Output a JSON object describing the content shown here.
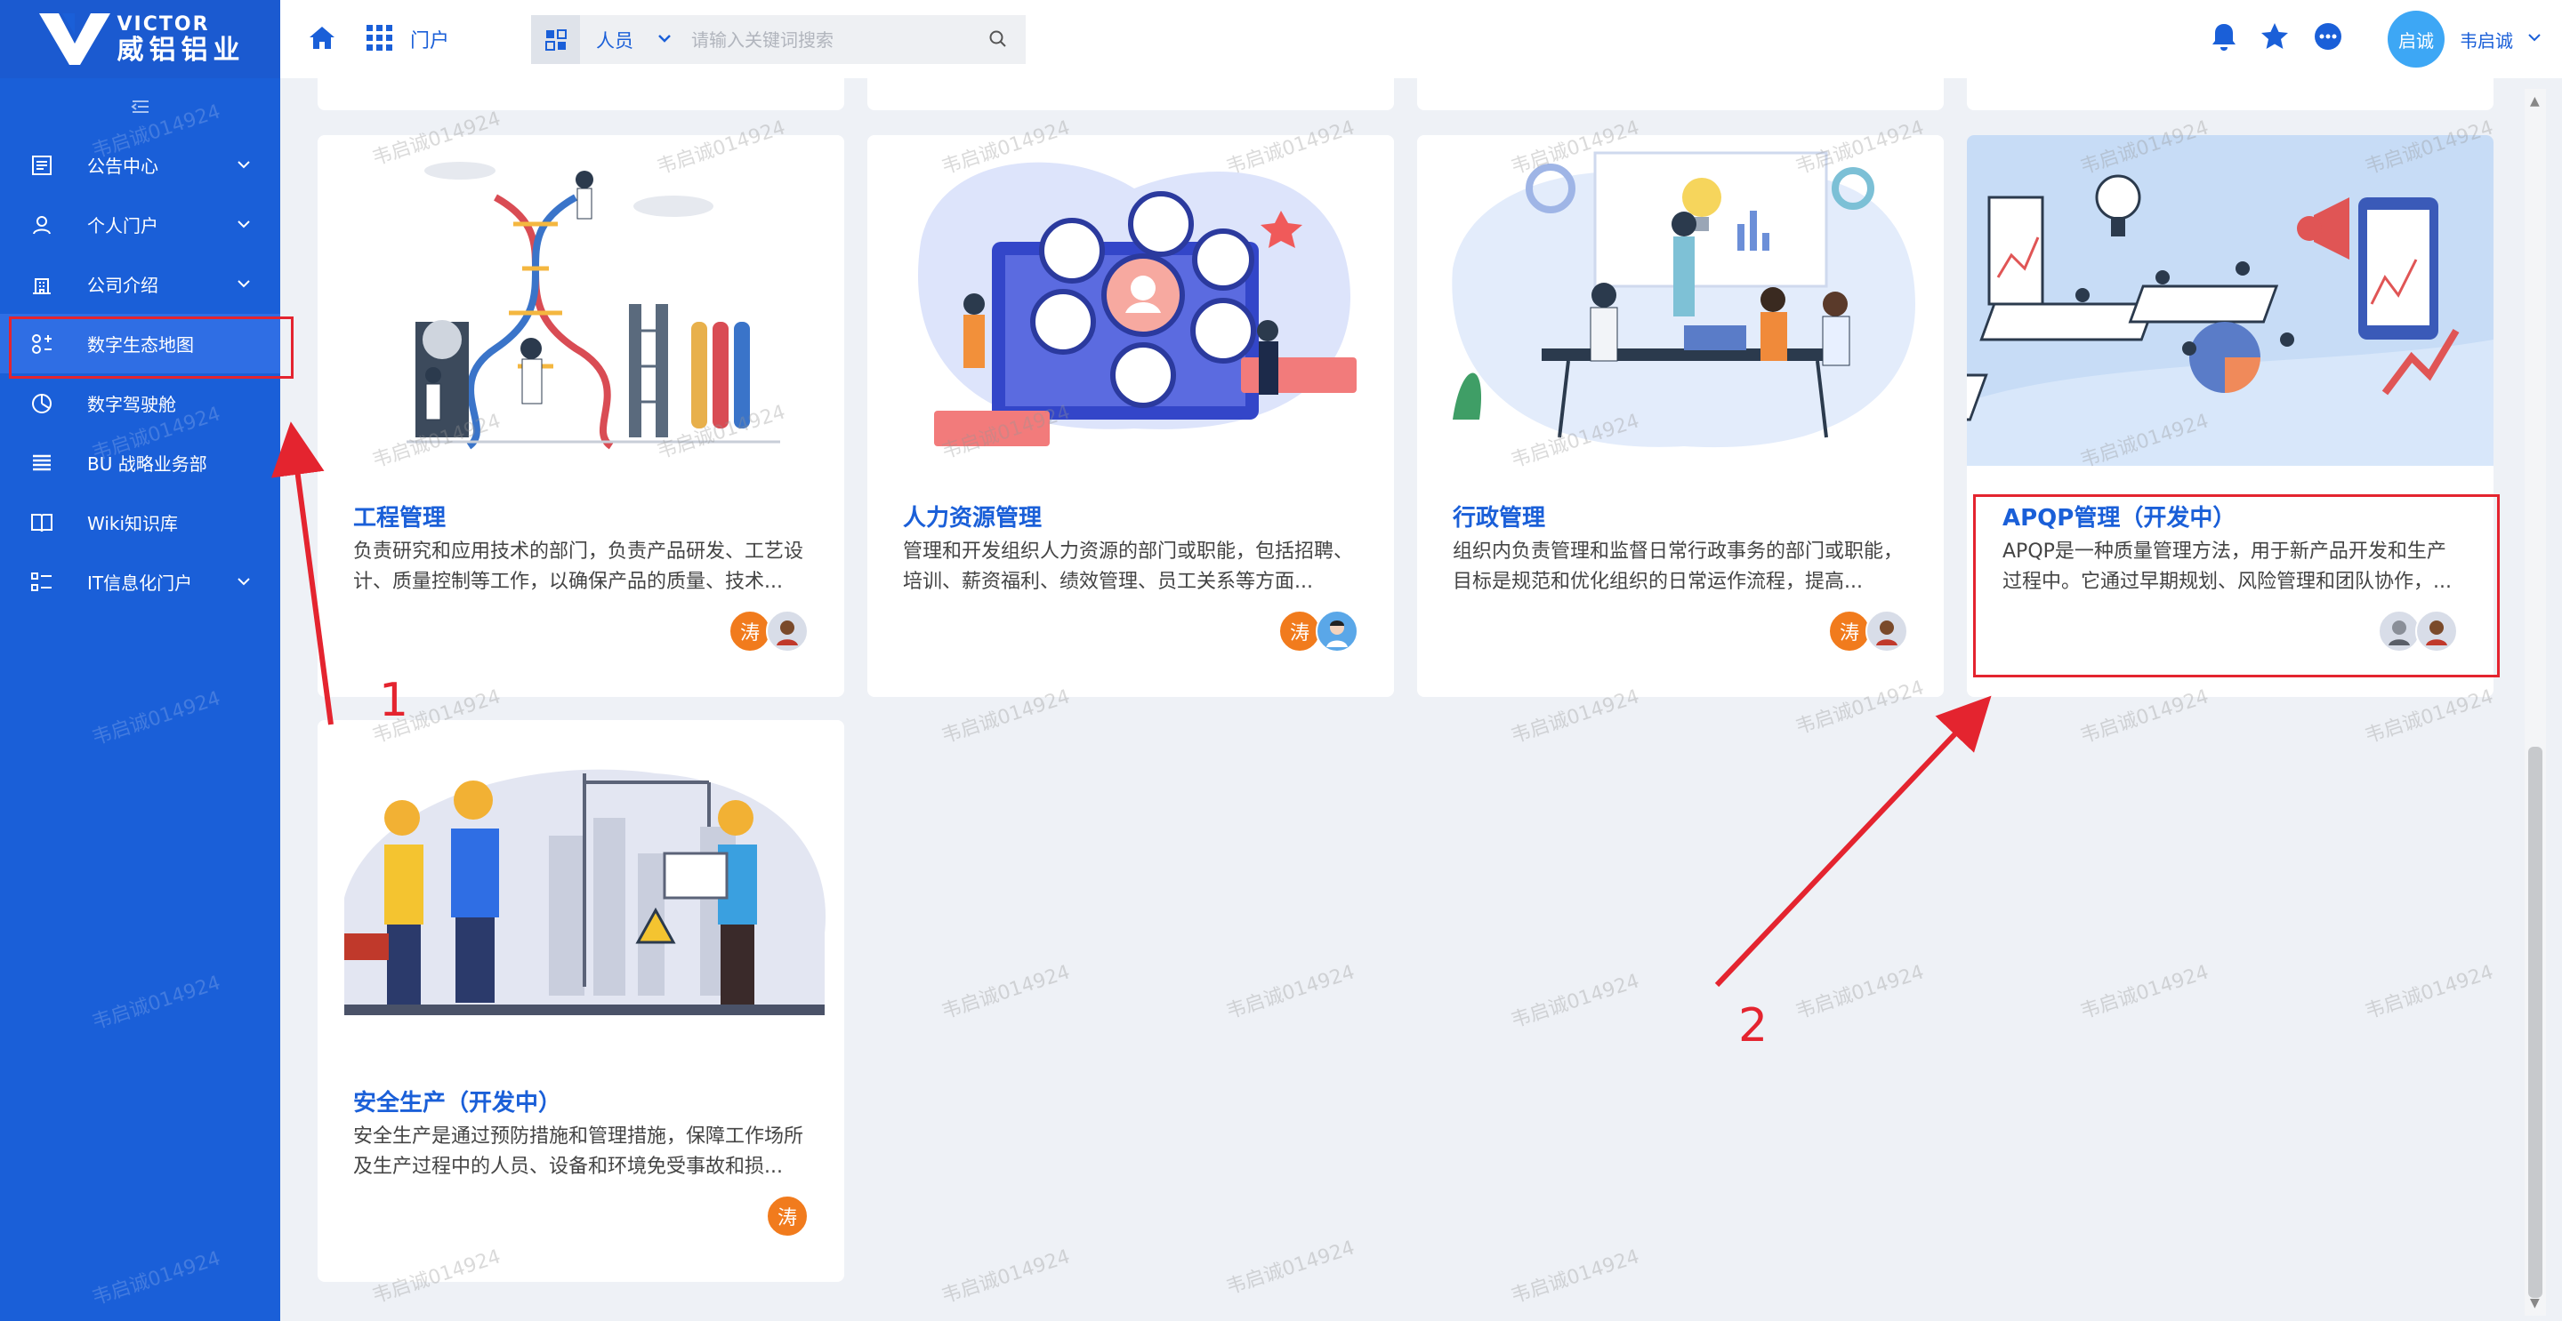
{
  "brand": {
    "name_en": "VICTOR",
    "name_cn": "威铝铝业"
  },
  "sidebar": {
    "items": [
      {
        "label": "公告中心",
        "icon": "notice-icon",
        "has_submenu": true
      },
      {
        "label": "个人门户",
        "icon": "person-icon",
        "has_submenu": true
      },
      {
        "label": "公司介绍",
        "icon": "building-icon",
        "has_submenu": true
      },
      {
        "label": "数字生态地图",
        "icon": "ecosystem-icon",
        "has_submenu": false,
        "active": true
      },
      {
        "label": "数字驾驶舱",
        "icon": "dashboard-icon",
        "has_submenu": false
      },
      {
        "label": "BU 战略业务部",
        "icon": "list-icon",
        "has_submenu": false
      },
      {
        "label": "Wiki知识库",
        "icon": "book-icon",
        "has_submenu": false
      },
      {
        "label": "IT信息化门户",
        "icon": "grid-list-icon",
        "has_submenu": true
      }
    ]
  },
  "header": {
    "portal_label": "门户",
    "search_scope": "人员",
    "search_placeholder": "请输入关键词搜索",
    "avatar_text": "启诚",
    "username": "韦启诚"
  },
  "cards": [
    {
      "title": "工程管理",
      "desc": "负责研究和应用技术的部门，负责产品研发、工艺设计、质量控制等工作，以确保产品的质量、技术...",
      "avatar_text": "涛"
    },
    {
      "title": "人力资源管理",
      "desc": "管理和开发组织人力资源的部门或职能，包括招聘、培训、薪资福利、绩效管理、员工关系等方面...",
      "avatar_text": "涛"
    },
    {
      "title": "行政管理",
      "desc": "组织内负责管理和监督日常行政事务的部门或职能，目标是规范和优化组织的日常运作流程，提高...",
      "avatar_text": "涛"
    },
    {
      "title": "APQP管理（开发中）",
      "desc": "APQP是一种质量管理方法，用于新产品开发和生产过程中。它通过早期规划、风险管理和团队协作，...",
      "avatar_text": ""
    },
    {
      "title": "安全生产（开发中）",
      "desc": "安全生产是通过预防措施和管理措施，保障工作场所及生产过程中的人员、设备和环境免受事故和损...",
      "avatar_text": "涛"
    }
  ],
  "annotations": {
    "one": "1",
    "two": "2"
  },
  "watermark": "韦启诚014924",
  "colors": {
    "primary": "#1a5fd8",
    "annotation": "#e4242f",
    "avatar_orange": "#f17b1d"
  }
}
